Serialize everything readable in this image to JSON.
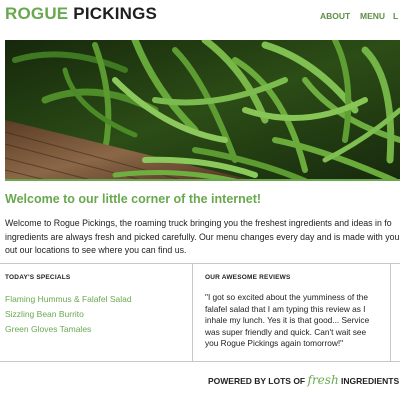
{
  "header": {
    "logo_part1": "ROGUE",
    "logo_part2": "PICKINGS",
    "nav": [
      "ABOUT",
      "MENU",
      "L"
    ]
  },
  "hero": {
    "icon": "green-beans-photo"
  },
  "welcome": {
    "title": "Welcome to our little corner of the internet!",
    "intro_lines": [
      "Welcome to Rogue Pickings, the roaming truck bringing you the freshest ingredients and ideas in fo",
      "ingredients are always fresh and picked carefully. Our menu changes every day and is made with you",
      "out our locations to see where you can find us."
    ]
  },
  "specials": {
    "heading": "TODAY'S SPECIALS",
    "items": [
      "Flaming Hummus & Falafel Salad",
      "Sizzling Bean Burrito",
      "Green Gloves Tamales"
    ]
  },
  "reviews": {
    "heading": "OUR AWESOME REVIEWS",
    "lines": [
      "\"I got so excited about the yumminess of the",
      "falafel salad that I am typing this review as I",
      "inhale my lunch. Yes it is that good... Service",
      "was super friendly and quick. Can't wait see",
      "you Rogue Pickings again tomorrow!\""
    ]
  },
  "footer": {
    "before": "POWERED BY LOTS OF ",
    "fresh": "fresh",
    "after": " INGREDIENTS"
  },
  "colors": {
    "accent": "#6aa84f",
    "nav": "#5e8f46",
    "text": "#222222"
  }
}
